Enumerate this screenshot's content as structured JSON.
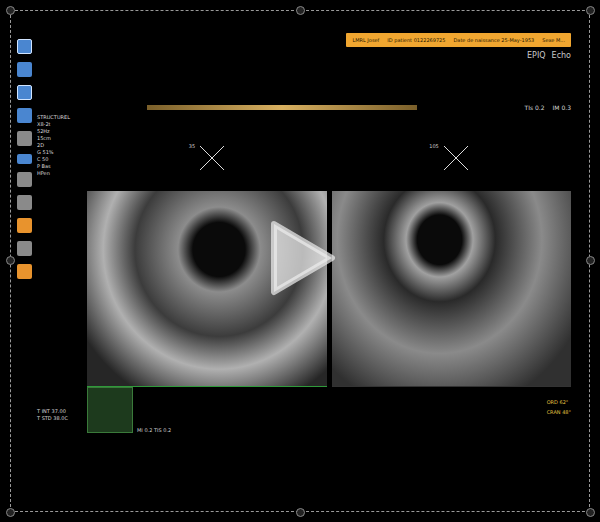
{
  "patient_bar": {
    "name": "LMRL Josef",
    "id": "ID patient 0122269725",
    "birth": "Date de naissance 25-May-1953",
    "sex": "Sexe M..."
  },
  "brand": {
    "model": "EPIQ",
    "mode": "Echo"
  },
  "params": [
    "STRUCTUREL",
    "X8-2t",
    "52Hz",
    "15cm",
    "2D",
    "G 51%",
    "C 50",
    "P Bas",
    "HPen"
  ],
  "indices": [
    "TIs 0.2",
    "IM 0.3"
  ],
  "views": [
    {
      "angle": "35"
    },
    {
      "angle": "105"
    }
  ],
  "temps": [
    "T INT 37.00",
    "T STD 38.0C"
  ],
  "bottom_left": "MI 0.2  TIS 0.2",
  "orientation": [
    "ORD 62°",
    "CRAN 48°"
  ],
  "player": {
    "playing": false
  }
}
